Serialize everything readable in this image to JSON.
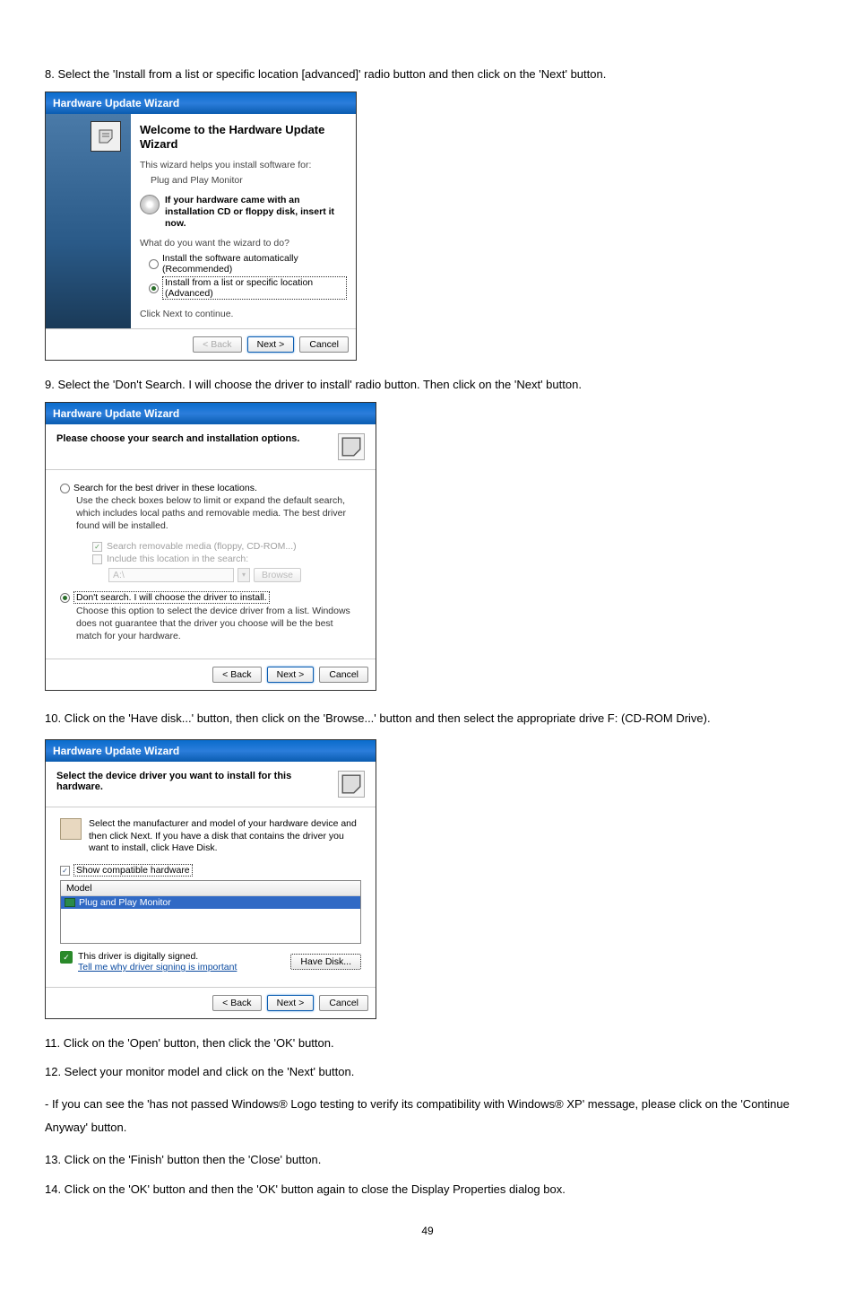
{
  "step8": "8. Select the 'Install from a list or specific location [advanced]' radio button and then click on the 'Next' button.",
  "step9": "9. Select the 'Don't Search. I will choose the driver to install' radio button. Then click on the 'Next' button.",
  "step10": "10. Click on the 'Have disk...' button, then click on the 'Browse...' button and then select the appropriate drive F: (CD-ROM Drive).",
  "step11": "11. Click on the 'Open' button, then click the 'OK' button.",
  "step12": "12. Select your monitor model and click on the 'Next' button.",
  "step12b": "- If you can see the 'has not passed Windows® Logo testing to verify its compatibility with Windows® XP' message, please click on the 'Continue Anyway' button.",
  "step13": "13. Click on the 'Finish' button then the 'Close' button.",
  "step14": "14. Click on the 'OK' button and then the 'OK' button again to close the Display Properties dialog box.",
  "dlg1": {
    "title": "Hardware Update Wizard",
    "welcome": "Welcome to the Hardware Update Wizard",
    "helps": "This wizard helps you install software for:",
    "device": "Plug and Play Monitor",
    "cd_msg": "If your hardware came with an installation CD or floppy disk, insert it now.",
    "what": "What do you want the wizard to do?",
    "opt1": "Install the software automatically (Recommended)",
    "opt2": "Install from a list or specific location (Advanced)",
    "continue": "Click Next to continue.",
    "back": "< Back",
    "next": "Next >",
    "cancel": "Cancel"
  },
  "dlg2": {
    "title": "Hardware Update Wizard",
    "header": "Please choose your search and installation options.",
    "opt1": "Search for the best driver in these locations.",
    "opt1_desc": "Use the check boxes below to limit or expand the default search, which includes local paths and removable media. The best driver found will be installed.",
    "chk1": "Search removable media (floppy, CD-ROM...)",
    "chk2": "Include this location in the search:",
    "path": "A:\\",
    "browse": "Browse",
    "opt2": "Don't search. I will choose the driver to install.",
    "opt2_desc": "Choose this option to select the device driver from a list. Windows does not guarantee that the driver you choose will be the best match for your hardware.",
    "back": "< Back",
    "next": "Next >",
    "cancel": "Cancel"
  },
  "dlg3": {
    "title": "Hardware Update Wizard",
    "header": "Select the device driver you want to install for this hardware.",
    "desc": "Select the manufacturer and model of your hardware device and then click Next. If you have a disk that contains the driver you want to install, click Have Disk.",
    "compat": "Show compatible hardware",
    "model_hdr": "Model",
    "model_item": "Plug and Play Monitor",
    "signed": "This driver is digitally signed.",
    "tell": "Tell me why driver signing is important",
    "have_disk": "Have Disk...",
    "back": "< Back",
    "next": "Next >",
    "cancel": "Cancel"
  },
  "page": "49"
}
